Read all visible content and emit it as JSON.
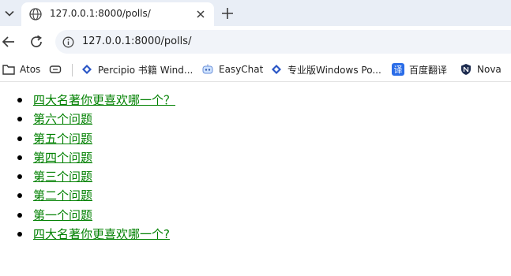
{
  "browser": {
    "tab": {
      "title": "127.0.0.1:8000/polls/"
    },
    "address_bar": {
      "url": "127.0.0.1:8000/polls/"
    },
    "bookmarks": [
      {
        "label": "Atos",
        "icon": "folder-icon"
      },
      {
        "label": "",
        "icon": "device-icon"
      },
      {
        "label": "Percipio 书籍 Wind...",
        "icon": "percipio-diamond-icon"
      },
      {
        "label": "EasyChat",
        "icon": "robot-icon"
      },
      {
        "label": "专业版Windows Po...",
        "icon": "percipio-diamond-icon"
      },
      {
        "label": "百度翻译",
        "icon": "translate-icon"
      },
      {
        "label": "Nova",
        "icon": "shield-icon"
      }
    ]
  },
  "page": {
    "link_color": "#008000",
    "polls": [
      {
        "text": "四大名著你更喜欢哪一个？"
      },
      {
        "text": "第六个问题"
      },
      {
        "text": "第五个问题"
      },
      {
        "text": "第四个问题"
      },
      {
        "text": "第三个问题"
      },
      {
        "text": "第二个问题"
      },
      {
        "text": "第一个问题"
      },
      {
        "text": "四大名著你更喜欢哪一个?"
      }
    ]
  }
}
